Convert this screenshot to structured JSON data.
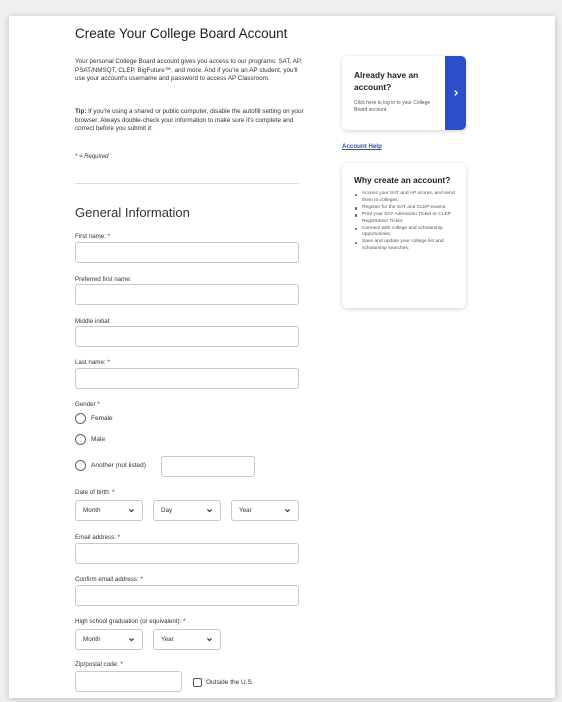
{
  "page": {
    "title": "Create Your College Board Account",
    "intro": "Your personal College Board account gives you access to our programs: SAT, AP, PSAT/NMSQT, CLEP, BigFuture™, and more. And if you're an AP student, you'll use your account's username and password to access AP Classroom.",
    "tip_label": "Tip:",
    "tip_text": " If you're using a shared or public computer, disable the autofill setting on your browser. Always double-check your information to make sure it's complete and correct before you submit it.",
    "required_note": "* = Required"
  },
  "form": {
    "section_title": "General Information",
    "first_name_label": "First name: *",
    "preferred_name_label": "Preferred first name:",
    "middle_initial_label": "Middle initial:",
    "last_name_label": "Last name: *",
    "gender_label": "Gender *",
    "gender_options": [
      "Female",
      "Male",
      "Another (not listed)"
    ],
    "dob_label": "Date of birth: *",
    "dob_month": "Month",
    "dob_day": "Day",
    "dob_year": "Year",
    "email_label": "Email address: *",
    "confirm_email_label": "Confirm email address: *",
    "grad_label": "High school graduation (or equivalent): *",
    "grad_month": "Month",
    "grad_year": "Year",
    "zip_label": "Zip/postal code: *",
    "outside_us_label": "Outside the U.S."
  },
  "sidebar": {
    "login_title": "Already have an account?",
    "login_text": "Click here to log in to your College Board account.",
    "login_icon": "chevron-right-icon",
    "account_help": "Account Help",
    "why_title": "Why create an account?",
    "why_items": [
      "Access your SAT and AP scores, and send them to colleges.",
      "Register for the SAT and CLEP exams.",
      "Print your SAT Admission Ticket or CLEP Registration Ticket.",
      "Connect with college and scholarship opportunities.",
      "Save and update your college list and scholarship searches."
    ]
  },
  "colors": {
    "accent": "#2d4ec9",
    "background": "#efefef",
    "card": "#ffffff"
  }
}
